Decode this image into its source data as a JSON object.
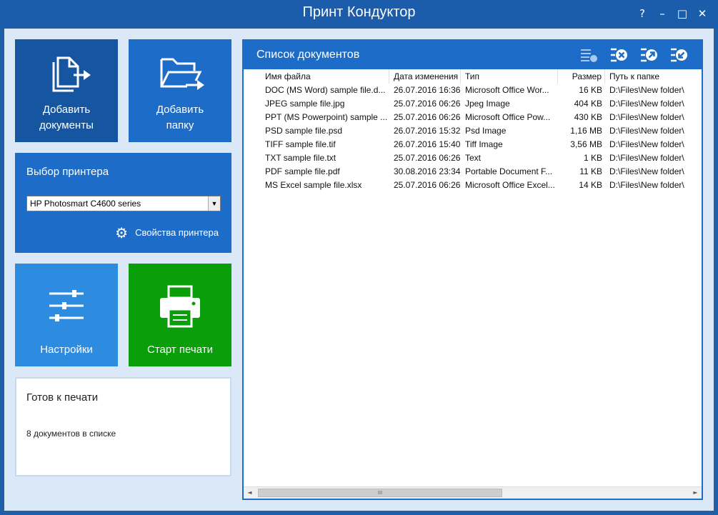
{
  "window": {
    "title": "Принт Кондуктор",
    "help": "?",
    "minimize": "–",
    "maximize": "□",
    "close": "✕"
  },
  "tiles": {
    "add_docs": {
      "line1": "Добавить",
      "line2": "документы",
      "icon": "add-documents-icon"
    },
    "add_folder": {
      "line1": "Добавить",
      "line2": "папку",
      "icon": "add-folder-icon"
    },
    "settings": {
      "label": "Настройки",
      "icon": "sliders-icon"
    },
    "start": {
      "label": "Старт печати",
      "icon": "printer-icon"
    }
  },
  "printer": {
    "title": "Выбор принтера",
    "selected": "HP Photosmart C4600 series",
    "properties_label": "Свойства принтера"
  },
  "status": {
    "title": "Готов к печати",
    "count": "8 документов в списке"
  },
  "doclist": {
    "title": "Список документов",
    "toolbar_icons": [
      "clear-list-icon",
      "remove-icon",
      "move-up-icon",
      "move-down-icon"
    ],
    "columns": [
      "Имя файла",
      "Дата изменения",
      "Тип",
      "Размер",
      "Путь к папке"
    ],
    "rows": [
      [
        "DOC (MS Word) sample file.d...",
        "26.07.2016 16:36",
        "Microsoft Office Wor...",
        "16 KB",
        "D:\\Files\\New folder\\"
      ],
      [
        "JPEG sample file.jpg",
        "25.07.2016 06:26",
        "Jpeg Image",
        "404 KB",
        "D:\\Files\\New folder\\"
      ],
      [
        "PPT (MS Powerpoint) sample ...",
        "25.07.2016 06:26",
        "Microsoft Office Pow...",
        "430 KB",
        "D:\\Files\\New folder\\"
      ],
      [
        "PSD sample file.psd",
        "26.07.2016 15:32",
        "Psd Image",
        "1,16 MB",
        "D:\\Files\\New folder\\"
      ],
      [
        "TIFF sample file.tif",
        "26.07.2016 15:40",
        "Tiff Image",
        "3,56 MB",
        "D:\\Files\\New folder\\"
      ],
      [
        "TXT sample file.txt",
        "25.07.2016 06:26",
        "Text",
        "1 KB",
        "D:\\Files\\New folder\\"
      ],
      [
        "PDF sample file.pdf",
        "30.08.2016 23:34",
        "Portable Document F...",
        "11 KB",
        "D:\\Files\\New folder\\"
      ],
      [
        "MS Excel sample file.xlsx",
        "25.07.2016 06:26",
        "Microsoft Office Excel...",
        "14 KB",
        "D:\\Files\\New folder\\"
      ]
    ],
    "scroll": {
      "left": "◄",
      "right": "►",
      "grip": "III"
    }
  },
  "colors": {
    "titlebar": "#1b5cab",
    "tile_dark": "#1656a0",
    "tile_blue": "#1d6cc8",
    "tile_light": "#2d8be0",
    "tile_green": "#0a9e0a"
  }
}
